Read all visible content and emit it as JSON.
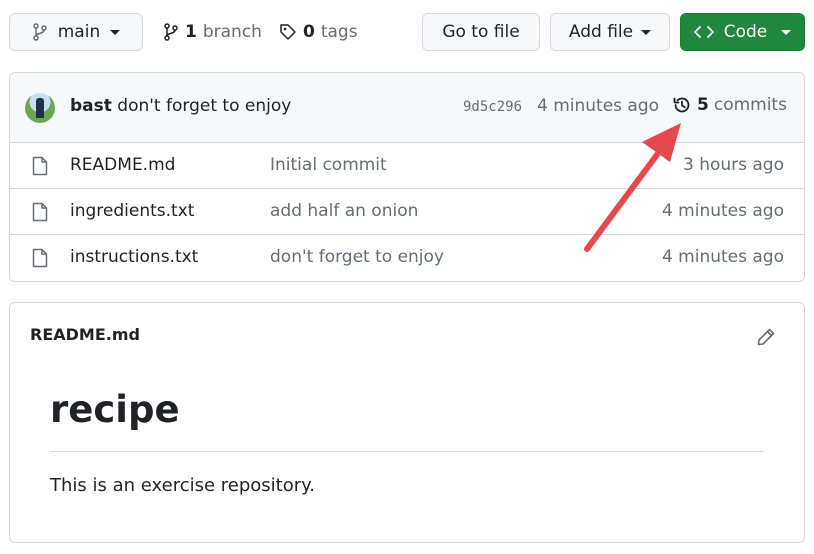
{
  "toolbar": {
    "branch_button_label": "main",
    "branch_count": "1",
    "branch_word": "branch",
    "tag_count": "0",
    "tag_word": "tags",
    "go_to_file_label": "Go to file",
    "add_file_label": "Add file",
    "code_label": "Code"
  },
  "latest_commit": {
    "author": "bast",
    "message": "don't forget to enjoy",
    "sha": "9d5c296",
    "time": "4 minutes ago",
    "commit_count": "5",
    "commit_word": "commits"
  },
  "files": [
    {
      "name": "README.md",
      "message": "Initial commit",
      "time": "3 hours ago"
    },
    {
      "name": "ingredients.txt",
      "message": "add half an onion",
      "time": "4 minutes ago"
    },
    {
      "name": "instructions.txt",
      "message": "don't forget to enjoy",
      "time": "4 minutes ago"
    }
  ],
  "readme": {
    "filename": "README.md",
    "heading": "recipe",
    "paragraph": "This is an exercise repository."
  },
  "icons": {
    "branch": "git-branch-icon",
    "tag": "tag-icon",
    "code": "code-icon",
    "history": "history-icon",
    "file": "file-icon",
    "edit": "pencil-icon"
  },
  "colors": {
    "code_button": "#1f883d",
    "annotation_arrow": "#e5484d"
  }
}
